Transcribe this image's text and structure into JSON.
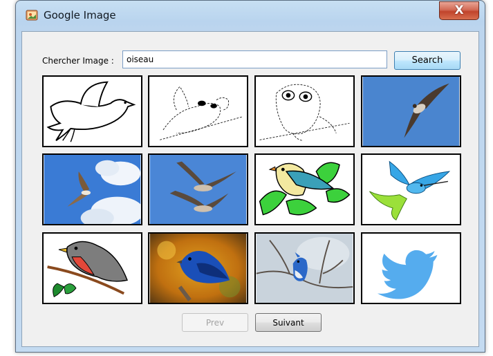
{
  "window": {
    "title": "Google Image",
    "close_symbol": "X"
  },
  "search": {
    "label": "Chercher Image :",
    "value": "oiseau",
    "button_label": "Search"
  },
  "results": {
    "images": [
      {
        "name": "image-result-bird-outline-drawing"
      },
      {
        "name": "image-result-bird-sketch-branch"
      },
      {
        "name": "image-result-owl-sketch"
      },
      {
        "name": "image-result-swift-blue-sky"
      },
      {
        "name": "image-result-gull-cloudy-sky"
      },
      {
        "name": "image-result-geese-flying"
      },
      {
        "name": "image-result-bird-clipart-leaves"
      },
      {
        "name": "image-result-hummingbird-clipart"
      },
      {
        "name": "image-result-robin-clipart"
      },
      {
        "name": "image-result-indigo-bunting-photo"
      },
      {
        "name": "image-result-blue-jay-photo"
      },
      {
        "name": "image-result-twitter-bird-logo"
      }
    ]
  },
  "pagination": {
    "prev_label": "Prev",
    "next_label": "Suivant",
    "prev_enabled": false
  },
  "colors": {
    "twitter_blue": "#55acee",
    "sky_blue": "#4a85cf",
    "close_red": "#c1442c"
  }
}
